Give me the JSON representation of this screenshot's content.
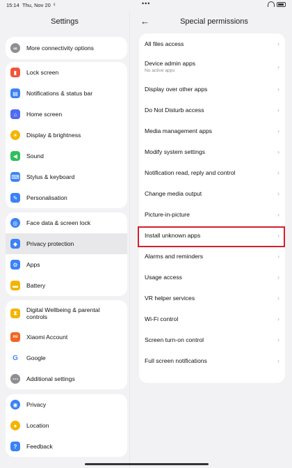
{
  "status": {
    "time": "15:14",
    "date": "Thu, Nov 20",
    "dots": "•••"
  },
  "left": {
    "title": "Settings",
    "groups": [
      {
        "items": [
          {
            "label": "More connectivity options",
            "icon": "link-icon",
            "color": "#8e8e93"
          }
        ]
      },
      {
        "items": [
          {
            "label": "Lock screen",
            "icon": "lock-icon",
            "color": "#f0553b"
          },
          {
            "label": "Notifications & status bar",
            "icon": "notification-icon",
            "color": "#3b82f6"
          },
          {
            "label": "Home screen",
            "icon": "home-icon",
            "color": "#4f6bf1"
          },
          {
            "label": "Display & brightness",
            "icon": "sun-icon",
            "color": "#f4b400"
          },
          {
            "label": "Sound",
            "icon": "speaker-icon",
            "color": "#2fbf5e"
          },
          {
            "label": "Stylus & keyboard",
            "icon": "keyboard-icon",
            "color": "#3b82f6"
          },
          {
            "label": "Personalisation",
            "icon": "brush-icon",
            "color": "#3b82f6"
          }
        ]
      },
      {
        "items": [
          {
            "label": "Face data & screen lock",
            "icon": "fingerprint-icon",
            "color": "#3b82f6"
          },
          {
            "label": "Privacy protection",
            "icon": "shield-icon",
            "color": "#3b82f6"
          },
          {
            "label": "Apps",
            "icon": "gear-icon",
            "color": "#3b82f6"
          },
          {
            "label": "Battery",
            "icon": "battery-icon",
            "color": "#f4b400"
          }
        ]
      },
      {
        "items": [
          {
            "label": "Digital Wellbeing & parental controls",
            "icon": "hourglass-icon",
            "color": "#f4b400"
          },
          {
            "label": "Xiaomi Account",
            "icon": "mi-icon",
            "color": "#f26522"
          },
          {
            "label": "Google",
            "icon": "google-icon",
            "color": "#ffffff"
          },
          {
            "label": "Additional settings",
            "icon": "more-icon",
            "color": "#8e8e93"
          }
        ]
      },
      {
        "items": [
          {
            "label": "Privacy",
            "icon": "eye-icon",
            "color": "#3b82f6"
          },
          {
            "label": "Location",
            "icon": "location-icon",
            "color": "#f4b400"
          },
          {
            "label": "Feedback",
            "icon": "feedback-icon",
            "color": "#3b82f6"
          }
        ]
      }
    ]
  },
  "right": {
    "title": "Special permissions",
    "rows": [
      {
        "label": "All files access"
      },
      {
        "label": "Device admin apps",
        "sub": "No active apps"
      },
      {
        "label": "Display over other apps"
      },
      {
        "label": "Do Not Disturb access"
      },
      {
        "label": "Media management apps"
      },
      {
        "label": "Modify system settings"
      },
      {
        "label": "Notification read, reply and control"
      },
      {
        "label": "Change media output"
      },
      {
        "label": "Picture-in-picture"
      },
      {
        "label": "Install unknown apps"
      },
      {
        "label": "Alarms and reminders"
      },
      {
        "label": "Usage access"
      },
      {
        "label": "VR helper services"
      },
      {
        "label": "Wi-Fi control"
      },
      {
        "label": "Screen turn-on control"
      },
      {
        "label": "Full screen notifications"
      }
    ]
  },
  "colors": {
    "highlight": "#d31f2b"
  }
}
